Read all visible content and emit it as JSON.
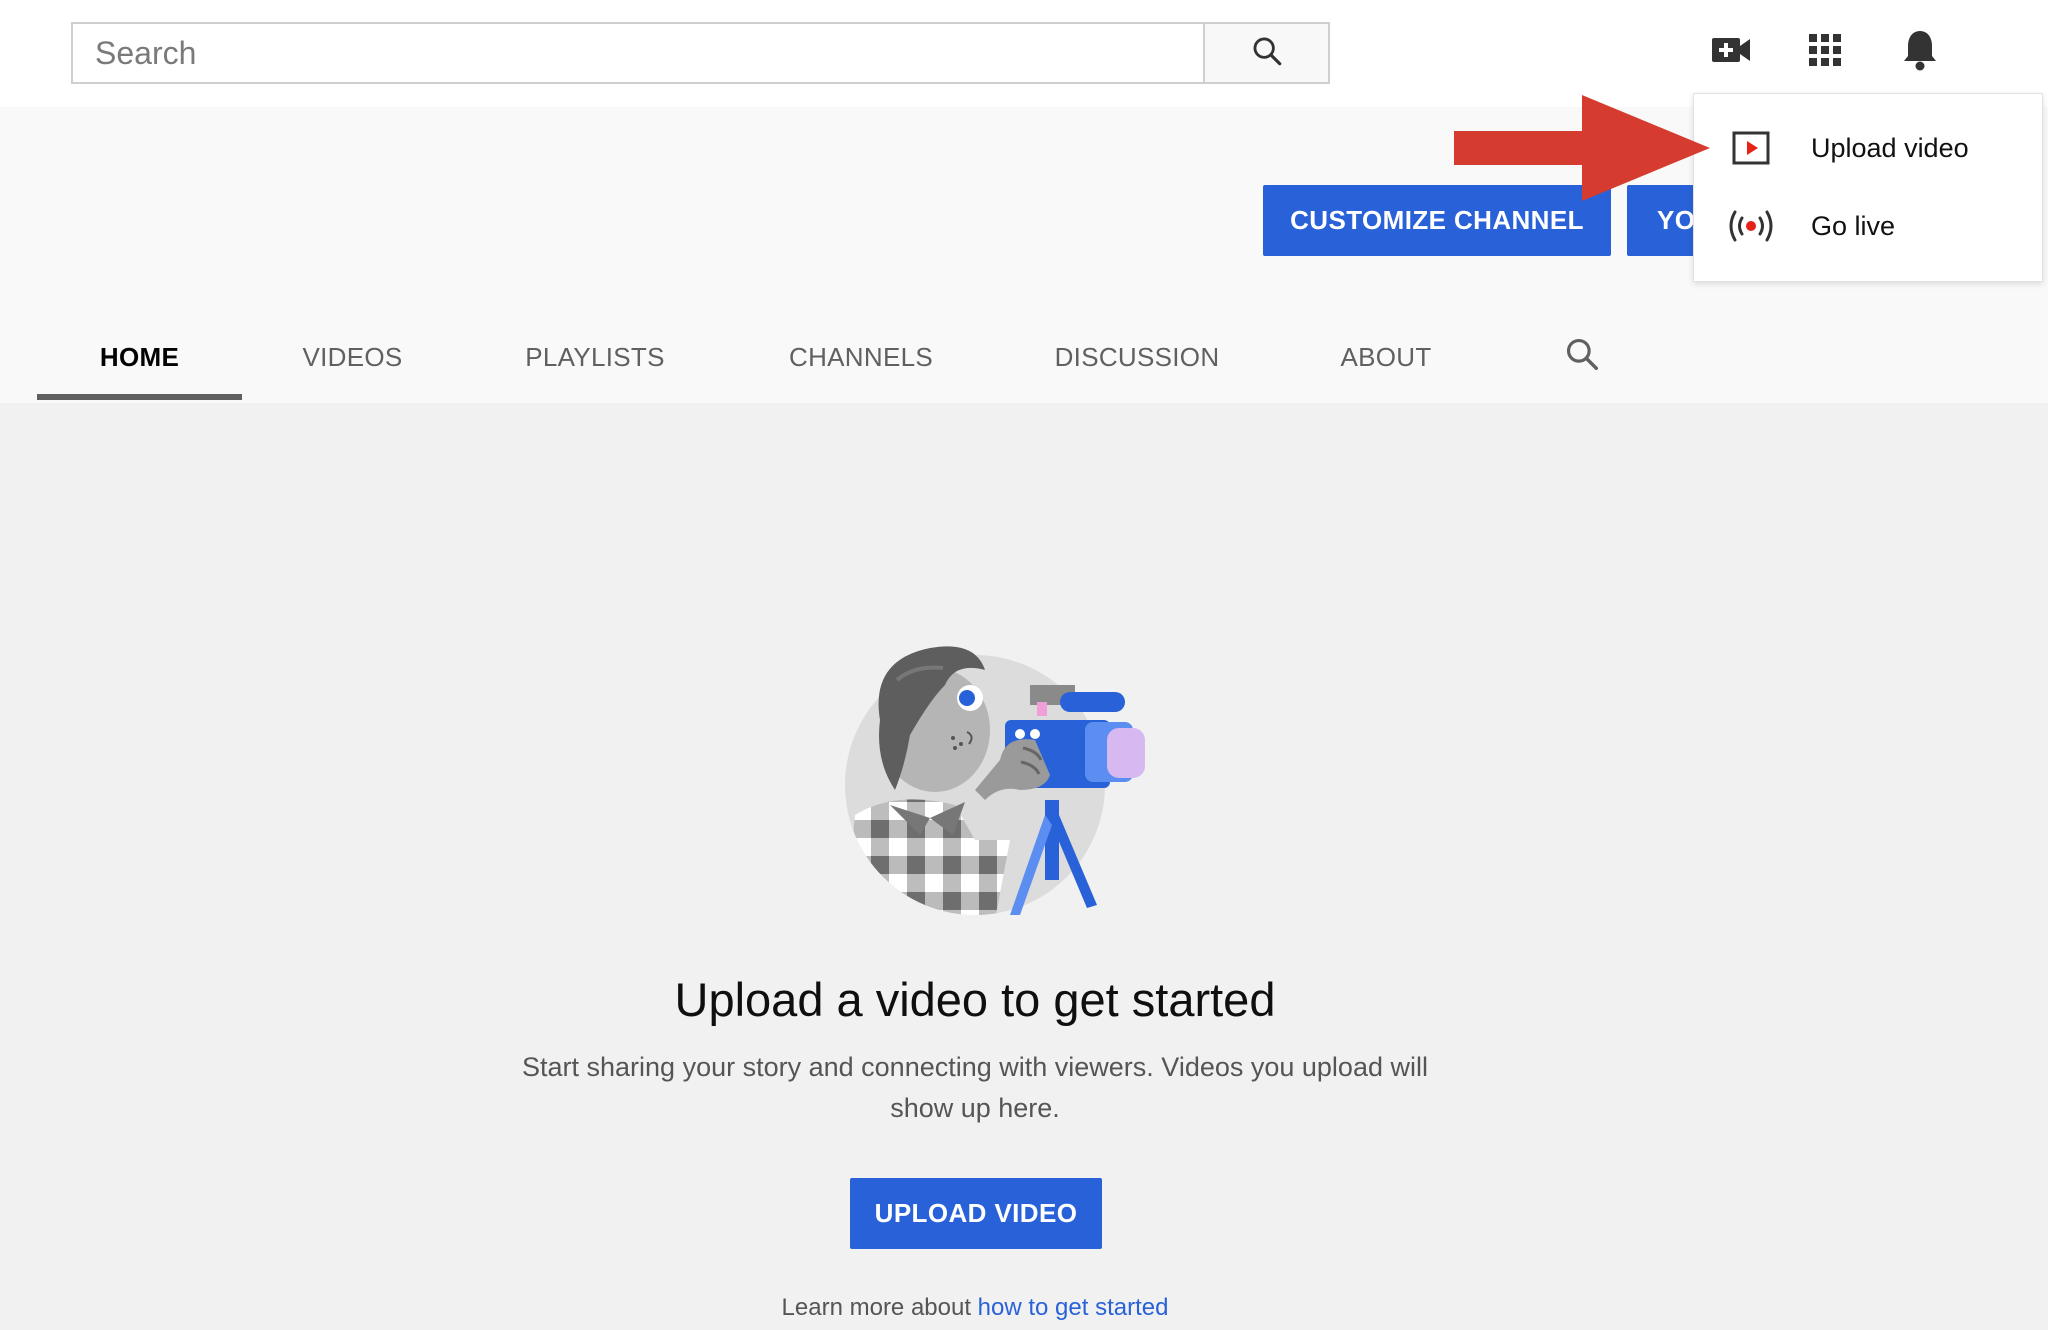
{
  "search": {
    "placeholder": "Search"
  },
  "header_icons": [
    "search-icon",
    "create-video-icon",
    "apps-grid-icon",
    "bell-icon"
  ],
  "channel": {
    "customize_label": "CUSTOMIZE CHANNEL",
    "second_button_label": "YO"
  },
  "tabs": [
    {
      "label": "HOME",
      "active": true
    },
    {
      "label": "VIDEOS",
      "active": false
    },
    {
      "label": "PLAYLISTS",
      "active": false
    },
    {
      "label": "CHANNELS",
      "active": false
    },
    {
      "label": "DISCUSSION",
      "active": false
    },
    {
      "label": "ABOUT",
      "active": false
    }
  ],
  "create_menu": {
    "items": [
      {
        "label": "Upload video",
        "icon": "upload-video-icon"
      },
      {
        "label": "Go live",
        "icon": "go-live-icon"
      }
    ]
  },
  "empty_state": {
    "title": "Upload a video to get started",
    "description": "Start sharing your story and connecting with viewers. Videos you upload will show up here.",
    "upload_button": "UPLOAD VIDEO",
    "learn_more_prefix": "Learn more about ",
    "learn_more_link": "how to get started"
  },
  "colors": {
    "accent_blue": "#2962d8",
    "annotation_red": "#d63b2f",
    "live_red": "#e62117"
  }
}
